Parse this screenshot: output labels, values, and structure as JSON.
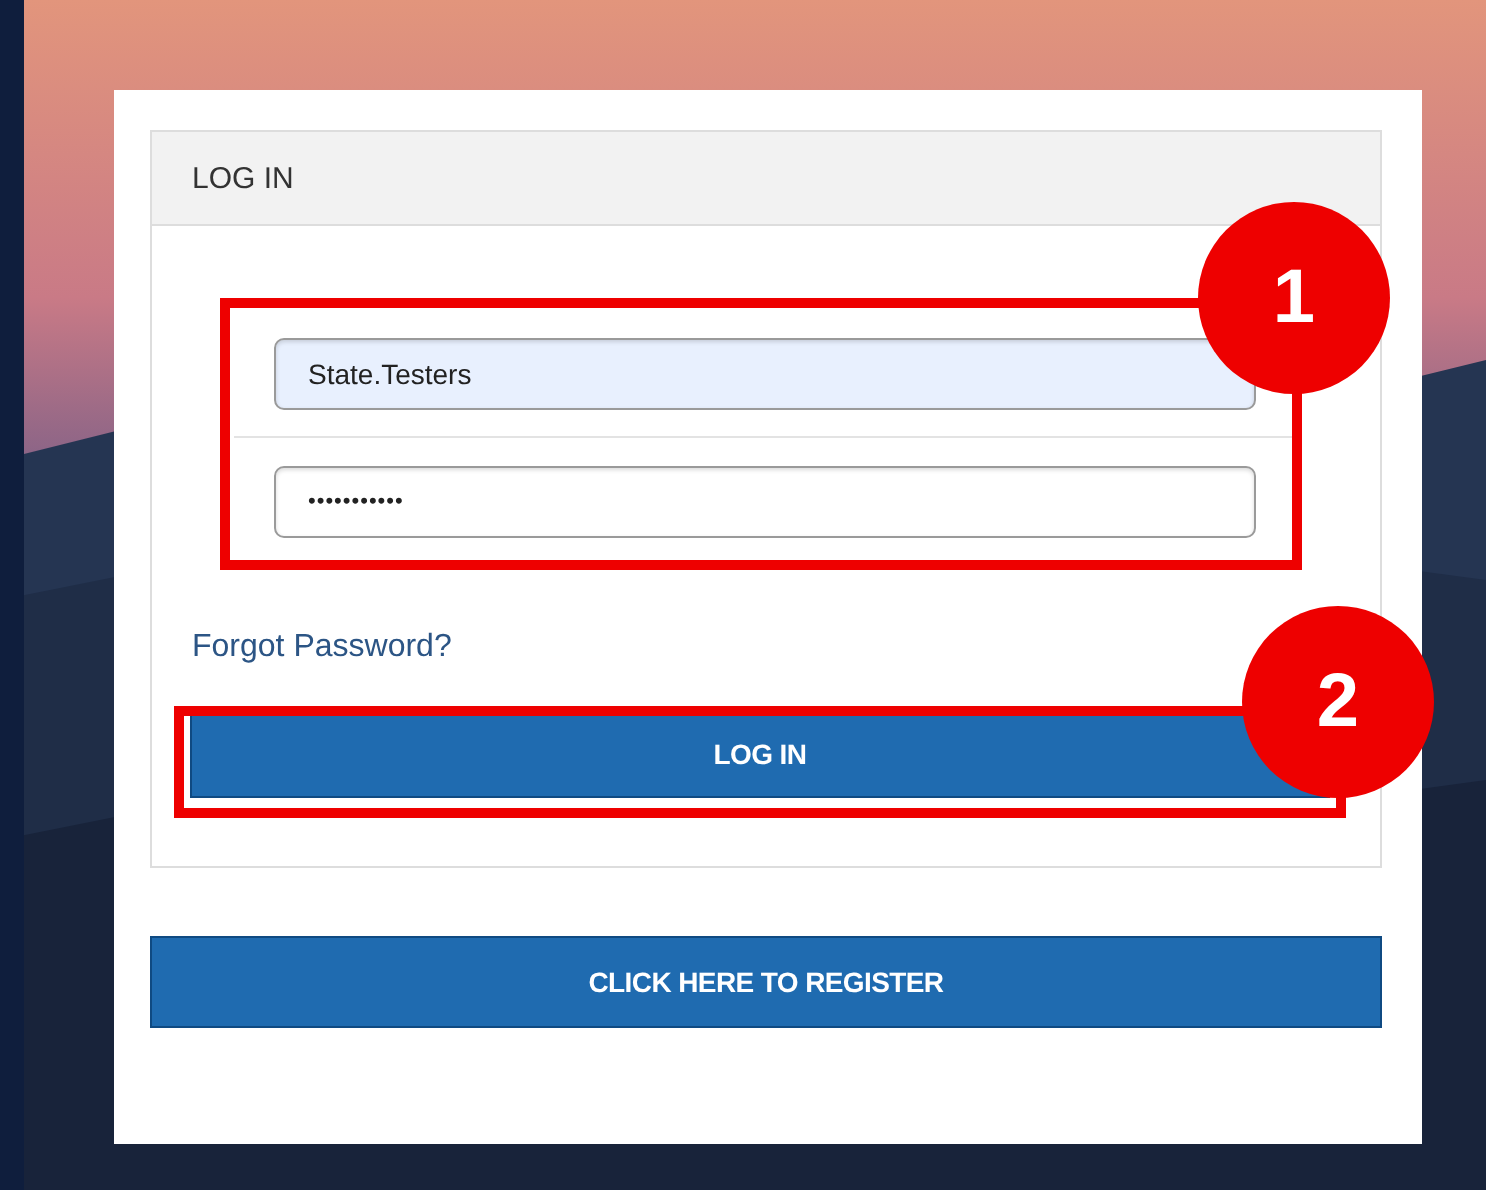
{
  "panel": {
    "title": "LOG IN"
  },
  "fields": [
    {
      "kind": "username",
      "value": "State.Testers",
      "autofilled": true
    },
    {
      "kind": "password",
      "value": "•••••••••••",
      "autofilled": false
    }
  ],
  "forgot_link": "Forgot Password?",
  "login_button": "LOG IN",
  "register_button": "CLICK HERE TO REGISTER",
  "annotations": [
    {
      "label": "1"
    },
    {
      "label": "2"
    }
  ]
}
